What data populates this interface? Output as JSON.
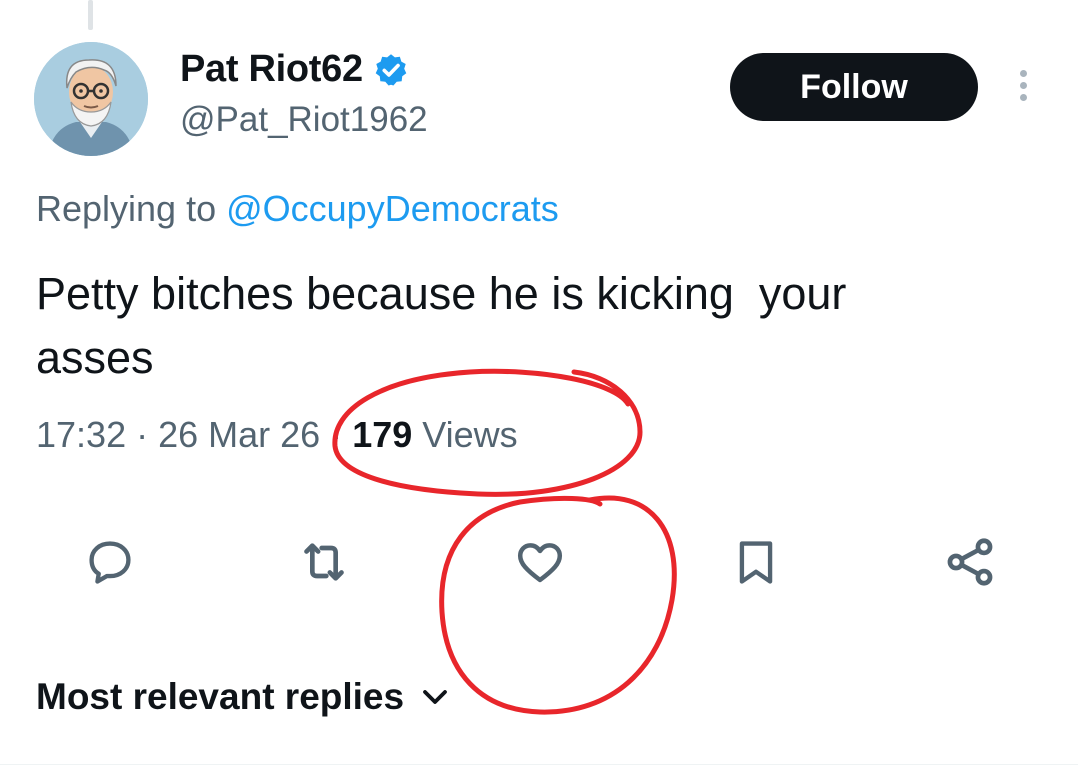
{
  "author": {
    "display_name": "Pat Riot62",
    "handle": "@Pat_Riot1962",
    "verified": true,
    "avatar_icon": "avatar-illustration-gray-haired-man-glasses"
  },
  "follow_button": {
    "label": "Follow"
  },
  "more_icon": "more-vertical-icon",
  "reply_context": {
    "prefix": "Replying to ",
    "mention": "@OccupyDemocrats"
  },
  "tweet": {
    "text": "Petty bitches because he is kicking  your\nasses"
  },
  "meta": {
    "time": "17:32",
    "date": "26 Mar 26",
    "separator": " · ",
    "views_count": "179",
    "views_label": " Views"
  },
  "actions": [
    {
      "name": "reply",
      "icon": "reply-icon"
    },
    {
      "name": "repost",
      "icon": "repost-icon"
    },
    {
      "name": "like",
      "icon": "heart-icon"
    },
    {
      "name": "bookmark",
      "icon": "bookmark-icon"
    },
    {
      "name": "share",
      "icon": "share-icon"
    }
  ],
  "replies_sort": {
    "label": "Most relevant replies",
    "icon": "chevron-down-icon"
  },
  "colors": {
    "text_primary": "#0f1419",
    "text_secondary": "#536471",
    "accent_blue": "#1d9bf0",
    "follow_button_bg": "#0f1419",
    "icon_gray": "#536471",
    "annotation_red": "#e8262b"
  },
  "annotations": [
    {
      "shape": "hand-drawn-circle",
      "target": "views-count",
      "color": "#e8262b"
    },
    {
      "shape": "hand-drawn-circle",
      "target": "like-button",
      "color": "#e8262b"
    }
  ]
}
